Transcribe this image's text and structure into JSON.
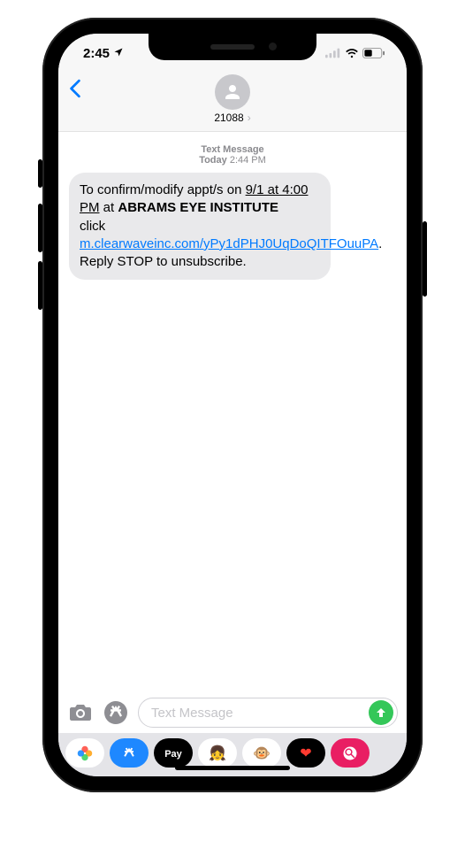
{
  "status": {
    "time": "2:45",
    "location_icon": "location-arrow",
    "signal_icon": "cellular",
    "wifi_icon": "wifi",
    "battery_icon": "battery-half"
  },
  "nav": {
    "back_icon": "chevron-left",
    "avatar_icon": "person-circle",
    "contact_name": "21088",
    "detail_icon": "chevron-right"
  },
  "thread_meta": {
    "label": "Text Message",
    "day": "Today",
    "time": "2:44 PM"
  },
  "message": {
    "pre": "To confirm/modify appt/s on ",
    "datetime": "9/1 at 4:00 PM",
    "at": " at ",
    "business": "ABRAMS EYE INSTITUTE",
    "click": " click ",
    "link": "m.clearwaveinc.com/yPy1dPHJ0UqDoQITFOuuPA",
    "post": ". Reply STOP to unsubscribe."
  },
  "compose": {
    "camera_icon": "camera",
    "appstore_icon": "appstore",
    "placeholder": "Text Message",
    "send_icon": "arrow-up"
  },
  "drawer": [
    {
      "name": "photos",
      "bg": "#fff",
      "fg": "#000",
      "glyph": "❁"
    },
    {
      "name": "appstore",
      "bg": "#1e88ff",
      "fg": "#fff",
      "glyph": ""
    },
    {
      "name": "applepay",
      "bg": "#000",
      "fg": "#fff",
      "glyph": "Pay"
    },
    {
      "name": "memoji1",
      "bg": "#fff",
      "fg": "#000",
      "glyph": "👧"
    },
    {
      "name": "memoji2",
      "bg": "#fff",
      "fg": "#000",
      "glyph": "🐵"
    },
    {
      "name": "heart",
      "bg": "#000",
      "fg": "#ff3b30",
      "glyph": "❤"
    },
    {
      "name": "search",
      "bg": "#e91e63",
      "fg": "#fff",
      "glyph": ""
    }
  ]
}
